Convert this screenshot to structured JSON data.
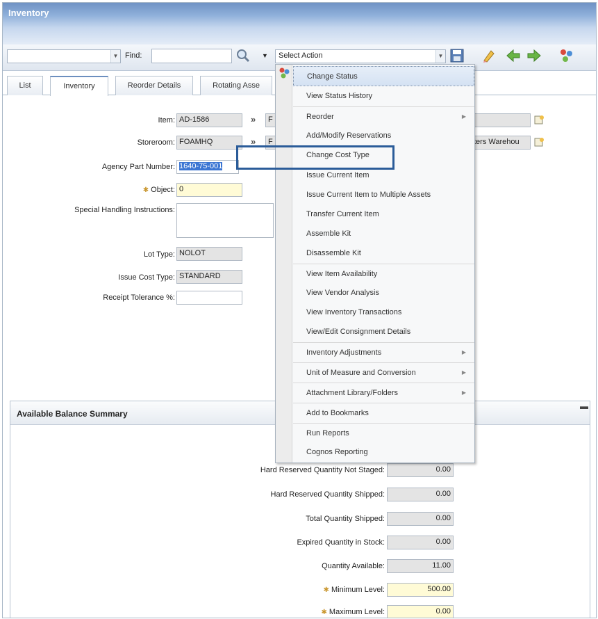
{
  "window": {
    "title": "Inventory"
  },
  "toolbar": {
    "find_label": "Find:",
    "find_value": "",
    "action_select": "Select Action"
  },
  "tabs": [
    "List",
    "Inventory",
    "Reorder Details",
    "Rotating Asse"
  ],
  "form": {
    "item_label": "Item:",
    "item_value": "AD-1586",
    "item_desc": "F",
    "storeroom_label": "Storeroom:",
    "storeroom_value": "FOAMHQ",
    "storeroom_desc": "F",
    "storeroom_desc2": "ters Warehou",
    "agency_label": "Agency Part Number:",
    "agency_value": "1640-75-001",
    "object_label": "Object:",
    "object_value": "0",
    "special_label": "Special Handling Instructions:",
    "special_value": "",
    "lot_label": "Lot Type:",
    "lot_value": "NOLOT",
    "issue_label": "Issue Cost Type:",
    "issue_value": "STANDARD",
    "receipt_label": "Receipt Tolerance %:",
    "receipt_value": ""
  },
  "balance": {
    "title": "Available Balance Summary",
    "rows": [
      {
        "label": "Hard Reserved Quantity Not Staged:",
        "value": "0.00"
      },
      {
        "label": "Hard Reserved Quantity Shipped:",
        "value": "0.00"
      },
      {
        "label": "Total Quantity Shipped:",
        "value": "0.00"
      },
      {
        "label": "Expired Quantity in Stock:",
        "value": "0.00"
      },
      {
        "label": "Quantity Available:",
        "value": "11.00"
      },
      {
        "label": "Minimum Level:",
        "value": "500.00"
      },
      {
        "label": "Maximum Level:",
        "value": "0.00"
      }
    ]
  },
  "menu": {
    "items": [
      {
        "label": "Change Status",
        "submenu": false
      },
      {
        "label": "View Status History",
        "submenu": false
      },
      {
        "label": "Reorder",
        "submenu": true
      },
      {
        "label": "Add/Modify Reservations",
        "submenu": false
      },
      {
        "label": "Change Cost Type",
        "submenu": false
      },
      {
        "label": "Issue Current Item",
        "submenu": false
      },
      {
        "label": "Issue Current Item to Multiple Assets",
        "submenu": false
      },
      {
        "label": "Transfer Current Item",
        "submenu": false
      },
      {
        "label": "Assemble Kit",
        "submenu": false
      },
      {
        "label": "Disassemble Kit",
        "submenu": false
      },
      {
        "label": "View Item Availability",
        "submenu": false
      },
      {
        "label": "View Vendor Analysis",
        "submenu": false
      },
      {
        "label": "View Inventory Transactions",
        "submenu": false
      },
      {
        "label": "View/Edit Consignment Details",
        "submenu": false
      },
      {
        "label": "Inventory Adjustments",
        "submenu": true
      },
      {
        "label": "Unit of Measure and Conversion",
        "submenu": true
      },
      {
        "label": "Attachment Library/Folders",
        "submenu": true
      },
      {
        "label": "Add to Bookmarks",
        "submenu": false
      },
      {
        "label": "Run Reports",
        "submenu": false
      },
      {
        "label": "Cognos Reporting",
        "submenu": false
      }
    ]
  },
  "colors": {
    "accent": "#2b5c99",
    "required": "#fffbd6",
    "title_bar": "#7f9fcf"
  }
}
